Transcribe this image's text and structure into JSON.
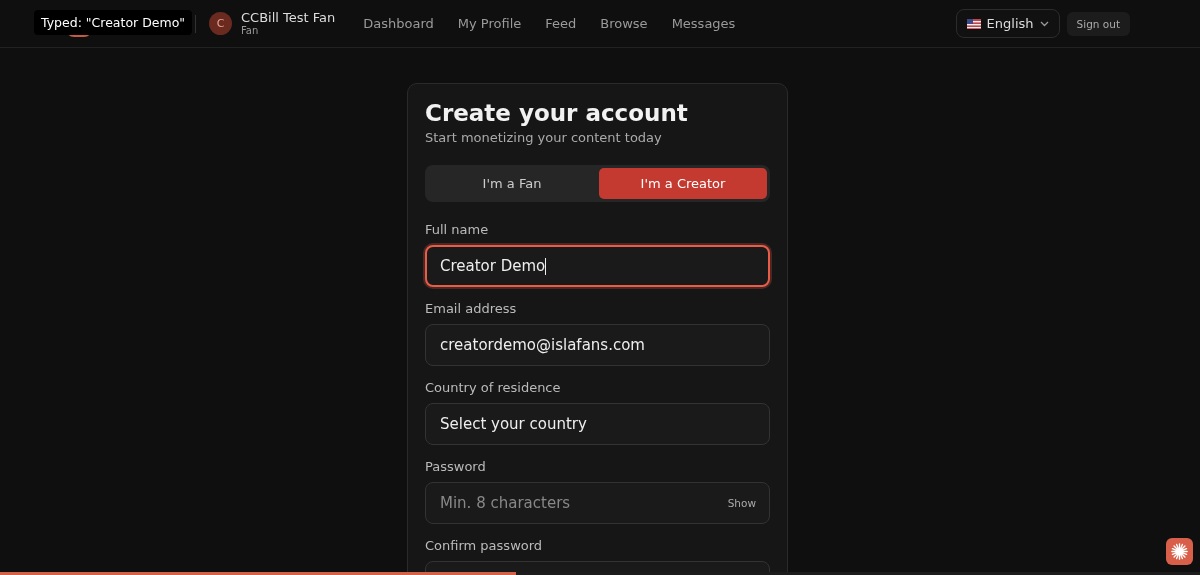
{
  "tooltip": "Typed: \"Creator Demo\"",
  "user": {
    "initial": "C",
    "name": "CCBill Test Fan",
    "role": "Fan"
  },
  "nav": [
    "Dashboard",
    "My Profile",
    "Feed",
    "Browse",
    "Messages"
  ],
  "language": "English",
  "sign_out": "Sign out",
  "form": {
    "title": "Create your account",
    "subtitle": "Start monetizing your content today",
    "account_types": [
      {
        "label": "I'm a Fan",
        "selected": false
      },
      {
        "label": "I'm a Creator",
        "selected": true
      }
    ],
    "fields": [
      {
        "kind": "text",
        "label": "Full name",
        "value": "Creator Demo",
        "focused": true
      },
      {
        "kind": "text",
        "label": "Email address",
        "value": "creatordemo@islafans.com",
        "focused": false
      },
      {
        "kind": "select",
        "label": "Country of residence",
        "value": "Select your country",
        "focused": false
      },
      {
        "kind": "password",
        "label": "Password",
        "placeholder": "Min. 8 characters",
        "toggle": "Show",
        "focused": false
      },
      {
        "kind": "password",
        "label": "Confirm password",
        "focused": false
      }
    ]
  },
  "progress": {
    "level": 0.43
  }
}
